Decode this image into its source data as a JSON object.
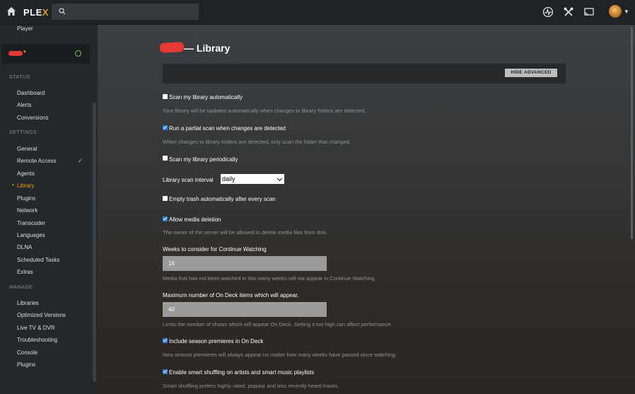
{
  "app": {
    "logo_text": "PLE",
    "logo_accent": "X"
  },
  "sidebar": {
    "top_item": "Player",
    "sections": {
      "status": "STATUS",
      "settings": "SETTINGS",
      "manage": "MANAGE"
    },
    "status_items": [
      "Dashboard",
      "Alerts",
      "Conversions"
    ],
    "settings_items": [
      "General",
      "Remote Access",
      "Agents",
      "Library",
      "Plugins",
      "Network",
      "Transcoder",
      "Languages",
      "DLNA",
      "Scheduled Tasks",
      "Extras"
    ],
    "manage_items": [
      "Libraries",
      "Optimized Versions",
      "Live TV & DVR",
      "Troubleshooting",
      "Console",
      "Plugins"
    ]
  },
  "main": {
    "title": "— Library",
    "hide_advanced": "HIDE ADVANCED",
    "options": {
      "scan_auto": {
        "label": "Scan my library automatically",
        "checked": false,
        "help": "Your library will be updated automatically when changes to library folders are detected."
      },
      "partial_scan": {
        "label": "Run a partial scan when changes are detected",
        "checked": true,
        "help": "When changes to library folders are detected, only scan the folder that changed."
      },
      "scan_periodic": {
        "label": "Scan my library periodically",
        "checked": false
      },
      "scan_interval": {
        "label": "Library scan interval",
        "value": "daily"
      },
      "empty_trash": {
        "label": "Empty trash automatically after every scan",
        "checked": false
      },
      "allow_deletion": {
        "label": "Allow media deletion",
        "checked": true,
        "help": "The owner of the server will be allowed to delete media files from disk."
      },
      "continue_weeks": {
        "label": "Weeks to consider for Continue Watching",
        "value": "16",
        "help": "Media that has not been watched in this many weeks will not appear in Continue Watching."
      },
      "ondeck_max": {
        "label": "Maximum number of On Deck items which will appear.",
        "value": "40",
        "help": "Limits the number of shows which will appear On Deck. Setting it too high can affect performance."
      },
      "season_premieres": {
        "label": "Include season premieres in On Deck",
        "checked": true,
        "help": "New season premieres will always appear no matter how many weeks have passed since watching."
      },
      "smart_shuffle": {
        "label": "Enable smart shuffling on artists and smart music playlists",
        "checked": true,
        "help": "Smart shuffling prefers highly rated, popular and less recently heard tracks."
      }
    }
  },
  "colors": {
    "accent": "#e5a00d",
    "ok": "#8bc34a",
    "checkbox": "#2a7de1"
  }
}
